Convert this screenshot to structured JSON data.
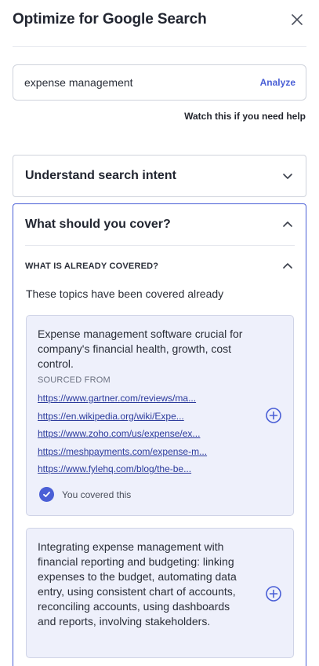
{
  "header": {
    "title": "Optimize for Google Search",
    "close_icon": "close-icon"
  },
  "search": {
    "value": "expense management",
    "analyze_label": "Analyze"
  },
  "help_link": "Watch this if you need help",
  "accordions": {
    "intent": {
      "title": "Understand search intent",
      "state": "collapsed"
    },
    "cover": {
      "title": "What should you cover?",
      "state": "expanded",
      "already_covered": {
        "title": "WHAT IS ALREADY COVERED?",
        "description": "These topics have been covered already",
        "cards": [
          {
            "topic": "Expense management software crucial for company's financial health, growth, cost control.",
            "sourced_label": "SOURCED FROM",
            "links": [
              "https://www.gartner.com/reviews/ma...",
              "https://en.wikipedia.org/wiki/Expe...",
              "https://www.zoho.com/us/expense/ex...",
              "https://meshpayments.com/expense-m...",
              "https://www.fylehq.com/blog/the-be..."
            ],
            "covered_label": "You covered this"
          },
          {
            "topic": "Integrating expense management with financial reporting and budgeting: linking expenses to the budget, automating data entry, using consistent chart of accounts, reconciling accounts, using dashboards and reports, involving stakeholders."
          }
        ]
      }
    }
  },
  "colors": {
    "accent": "#4a5fd6",
    "card_bg": "#eef0fb",
    "link": "#2b3a9c"
  }
}
